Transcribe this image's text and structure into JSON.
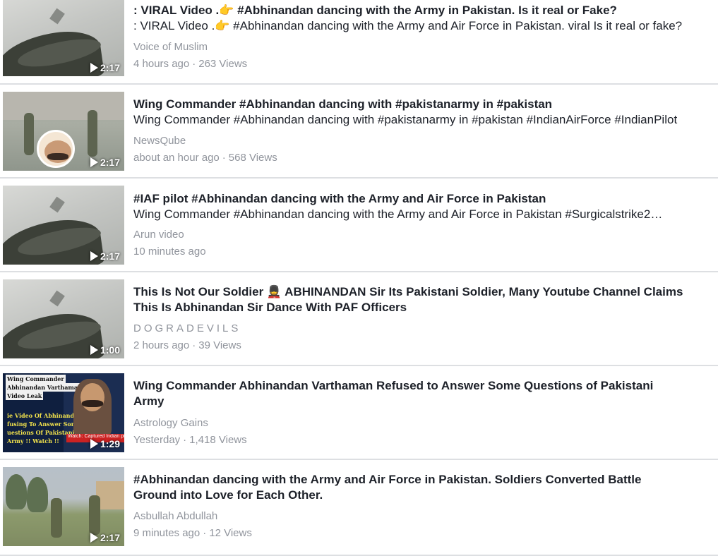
{
  "videos": [
    {
      "title": ": VIRAL Video .👉 #Abhinandan dancing with the Army in Pakistan. Is it real or Fake?",
      "description": ": VIRAL Video .👉 #Abhinandan dancing with the Army and Air Force in Pakistan. viral Is it real or fake?",
      "channel": "Voice of Muslim",
      "time": "4 hours ago",
      "views": "263 Views",
      "duration": "2:17",
      "thumbnail": "wall"
    },
    {
      "title": "Wing Commander #Abhinandan dancing with #pakistanarmy in #pakistan",
      "description": "Wing Commander #Abhinandan dancing with #pakistanarmy in #pakistan #IndianAirForce #IndianPilot",
      "channel": "NewsQube",
      "time": "about an hour ago",
      "views": "568 Views",
      "duration": "2:17",
      "thumbnail": "yard"
    },
    {
      "title": "#IAF pilot #Abhinandan dancing with the Army and Air Force in Pakistan",
      "description": "Wing Commander #Abhinandan dancing with the Army and Air Force in Pakistan #Surgicalstrike2…",
      "channel": "Arun video",
      "time": "10 minutes ago",
      "views": "",
      "duration": "2:17",
      "thumbnail": "wall"
    },
    {
      "title": "This Is Not Our Soldier 💂 ABHINANDAN Sir Its Pakistani Soldier, Many Youtube Channel Claims This Is Abhinandan Sir Dance With PAF Officers",
      "description": "",
      "channel": "DOGRADEVILS",
      "time": "2 hours ago",
      "views": "39 Views",
      "duration": "1:00",
      "thumbnail": "wall"
    },
    {
      "title": "Wing Commander Abhinandan Varthaman Refused to Answer Some Questions of Pakistani Army",
      "description": "",
      "channel": "Astrology Gains",
      "time": "Yesterday",
      "views": "1,418 Views",
      "duration": "1:29",
      "thumbnail": "news",
      "thumb_captions": [
        "Wing Commander",
        "Abhinandan Varthaman",
        "Video Leak",
        "ie Video Of Abhinandan",
        "fusing To Answer Some",
        "uestions Of Pakistani",
        "Army !! Watch !!"
      ],
      "thumb_ticker": "Watch: Captured Indian pilot"
    },
    {
      "title": "#Abhinandan dancing with the Army and Air Force in Pakistan. Soldiers Converted Battle Ground into Love for Each Other.",
      "description": "",
      "channel": "Asbullah Abdullah",
      "time": "9 minutes ago",
      "views": "12 Views",
      "duration": "2:17",
      "thumbnail": "field"
    }
  ],
  "separator": "·",
  "colors": {
    "title": "#1d2129",
    "meta": "#90949c",
    "divider": "#dddfe2"
  }
}
